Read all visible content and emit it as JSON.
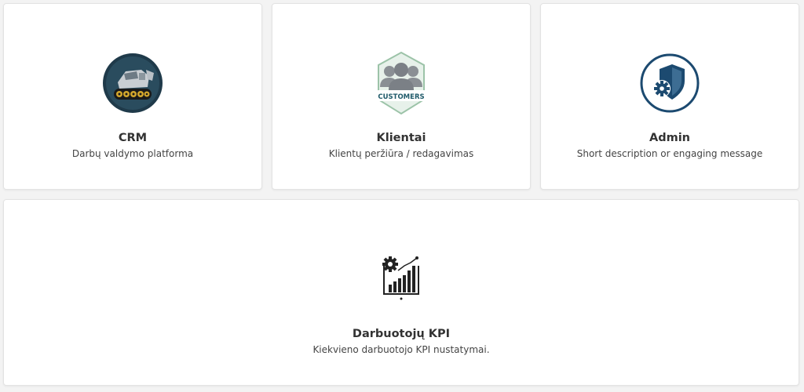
{
  "cards": [
    {
      "id": "crm",
      "title": "CRM",
      "description": "Darbų valdymo platforma",
      "icon": "excavator-logo-icon"
    },
    {
      "id": "klientai",
      "title": "Klientai",
      "description": "Klientų peržiūra / redagavimas",
      "icon": "customers-icon",
      "icon_text": "CUSTOMERS"
    },
    {
      "id": "admin",
      "title": "Admin",
      "description": "Short description or engaging message",
      "icon": "shield-gear-icon"
    },
    {
      "id": "kpi",
      "title": "Darbuotojų KPI",
      "description": "Kiekvieno darbuotojo KPI nustatymai.",
      "icon": "kpi-chart-gear-icon"
    }
  ],
  "colors": {
    "background": "#f3f3f3",
    "card": "#ffffff",
    "admin_blue": "#1c4a70",
    "customers_teal": "#1f5a6a",
    "crm_dark": "#1f3a4a",
    "crm_gold": "#d4a72c"
  }
}
